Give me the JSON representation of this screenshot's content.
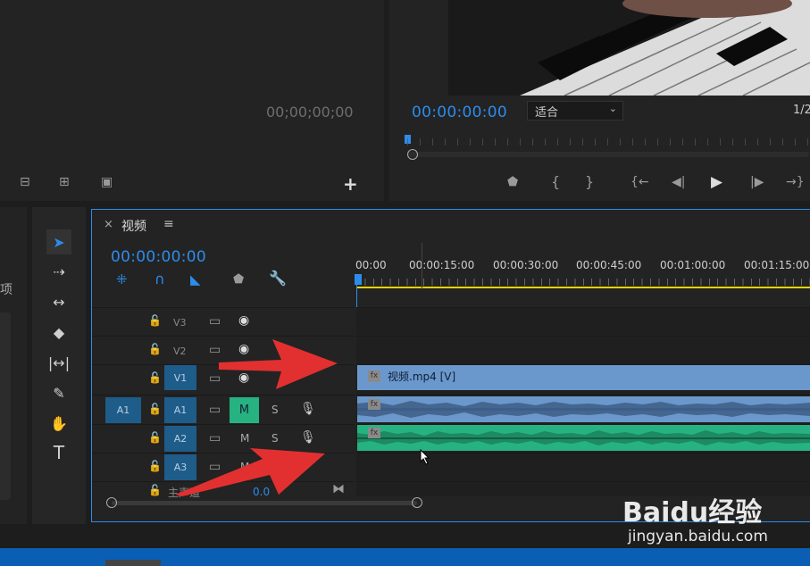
{
  "source_monitor": {
    "timecode": "00;00;00;00"
  },
  "program_monitor": {
    "timecode": "00:00:00:00",
    "fit_label": "适合",
    "resolution_partial": "1/2"
  },
  "left_panel": {
    "partial_label": "项"
  },
  "timeline": {
    "close_label": "×",
    "title": "视频",
    "menu_label": "≡",
    "timecode": "00:00:00:00",
    "ruler_labels": [
      "00:00",
      "00:00:15:00",
      "00:00:30:00",
      "00:00:45:00",
      "00:01:00:00",
      "00:01:15:00"
    ],
    "tracks": [
      {
        "label": "V3"
      },
      {
        "label": "V2"
      },
      {
        "label": "V1"
      },
      {
        "label": "A1",
        "source": "A1",
        "m": "M",
        "s": "S"
      },
      {
        "label": "A2",
        "m": "M",
        "s": "S"
      },
      {
        "label": "A3",
        "m": "M"
      }
    ],
    "master": {
      "label": "主声道",
      "value": "0.0"
    },
    "video_clip": {
      "fx": "fx",
      "name": "视频.mp4 [V]"
    },
    "audio_clip_fx": "fx"
  },
  "watermark": {
    "brand": "Baidu经验",
    "url": "jingyan.baidu.com"
  },
  "colors": {
    "accent": "#2d8ceb",
    "clip_video": "#6b98cc",
    "clip_audio_green": "#27b281",
    "arrow": "#e23030"
  }
}
